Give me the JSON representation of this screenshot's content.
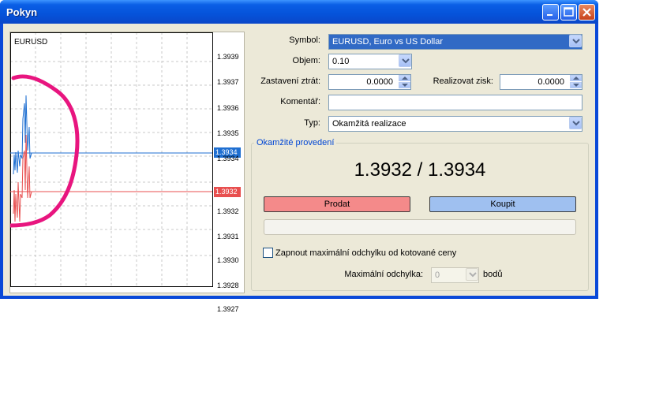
{
  "window": {
    "title": "Pokyn"
  },
  "chart": {
    "symbol": "EURUSD",
    "price_ticks": [
      "1.3939",
      "1.3937",
      "1.3936",
      "1.3935",
      "1.3934",
      "1.3932",
      "1.3931",
      "1.3930",
      "1.3928",
      "1.3927"
    ],
    "ask_tag": "1.3934",
    "bid_tag": "1.3932",
    "ask_color": "#1f6fd1",
    "bid_color": "#e84f4f"
  },
  "form": {
    "symbol_label": "Symbol:",
    "symbol_value": "EURUSD, Euro vs US Dollar",
    "volume_label": "Objem:",
    "volume_value": "0.10",
    "stoploss_label": "Zastavení ztrát:",
    "stoploss_value": "0.0000",
    "takeprofit_label": "Realizovat zisk:",
    "takeprofit_value": "0.0000",
    "comment_label": "Komentář:",
    "comment_value": "",
    "type_label": "Typ:",
    "type_value": "Okamžitá realizace"
  },
  "execution": {
    "group_title": "Okamžité provedení",
    "price_display": "1.3932 / 1.3934",
    "sell_label": "Prodat",
    "buy_label": "Koupit",
    "deviation_checkbox_label": "Zapnout maximální odchylku od kotované ceny",
    "deviation_checked": false,
    "max_deviation_label": "Maximální odchylka:",
    "max_deviation_value": "0",
    "points_unit": "bodů"
  }
}
